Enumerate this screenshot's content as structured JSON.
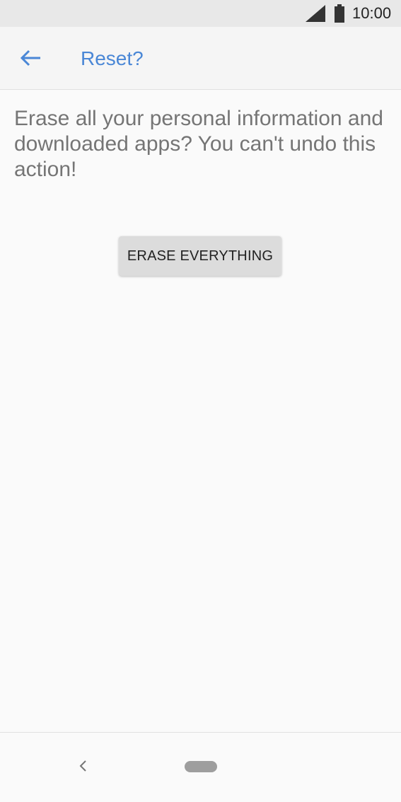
{
  "status_bar": {
    "time": "10:00",
    "icons": [
      "signal-icon",
      "battery-icon"
    ]
  },
  "app_bar": {
    "back_icon": "arrow-back-icon",
    "title": "Reset?"
  },
  "content": {
    "message": "Erase all your personal information and downloaded apps? You can't undo this action!",
    "erase_button_label": "ERASE EVERYTHING"
  },
  "nav_bar": {
    "back_icon": "chevron-left-icon",
    "home_icon": "home-pill-icon"
  },
  "colors": {
    "accent": "#4a87d6",
    "body_text": "#757575",
    "button_bg": "#dcdcdc",
    "status_bar_bg": "#e8e8e8"
  }
}
